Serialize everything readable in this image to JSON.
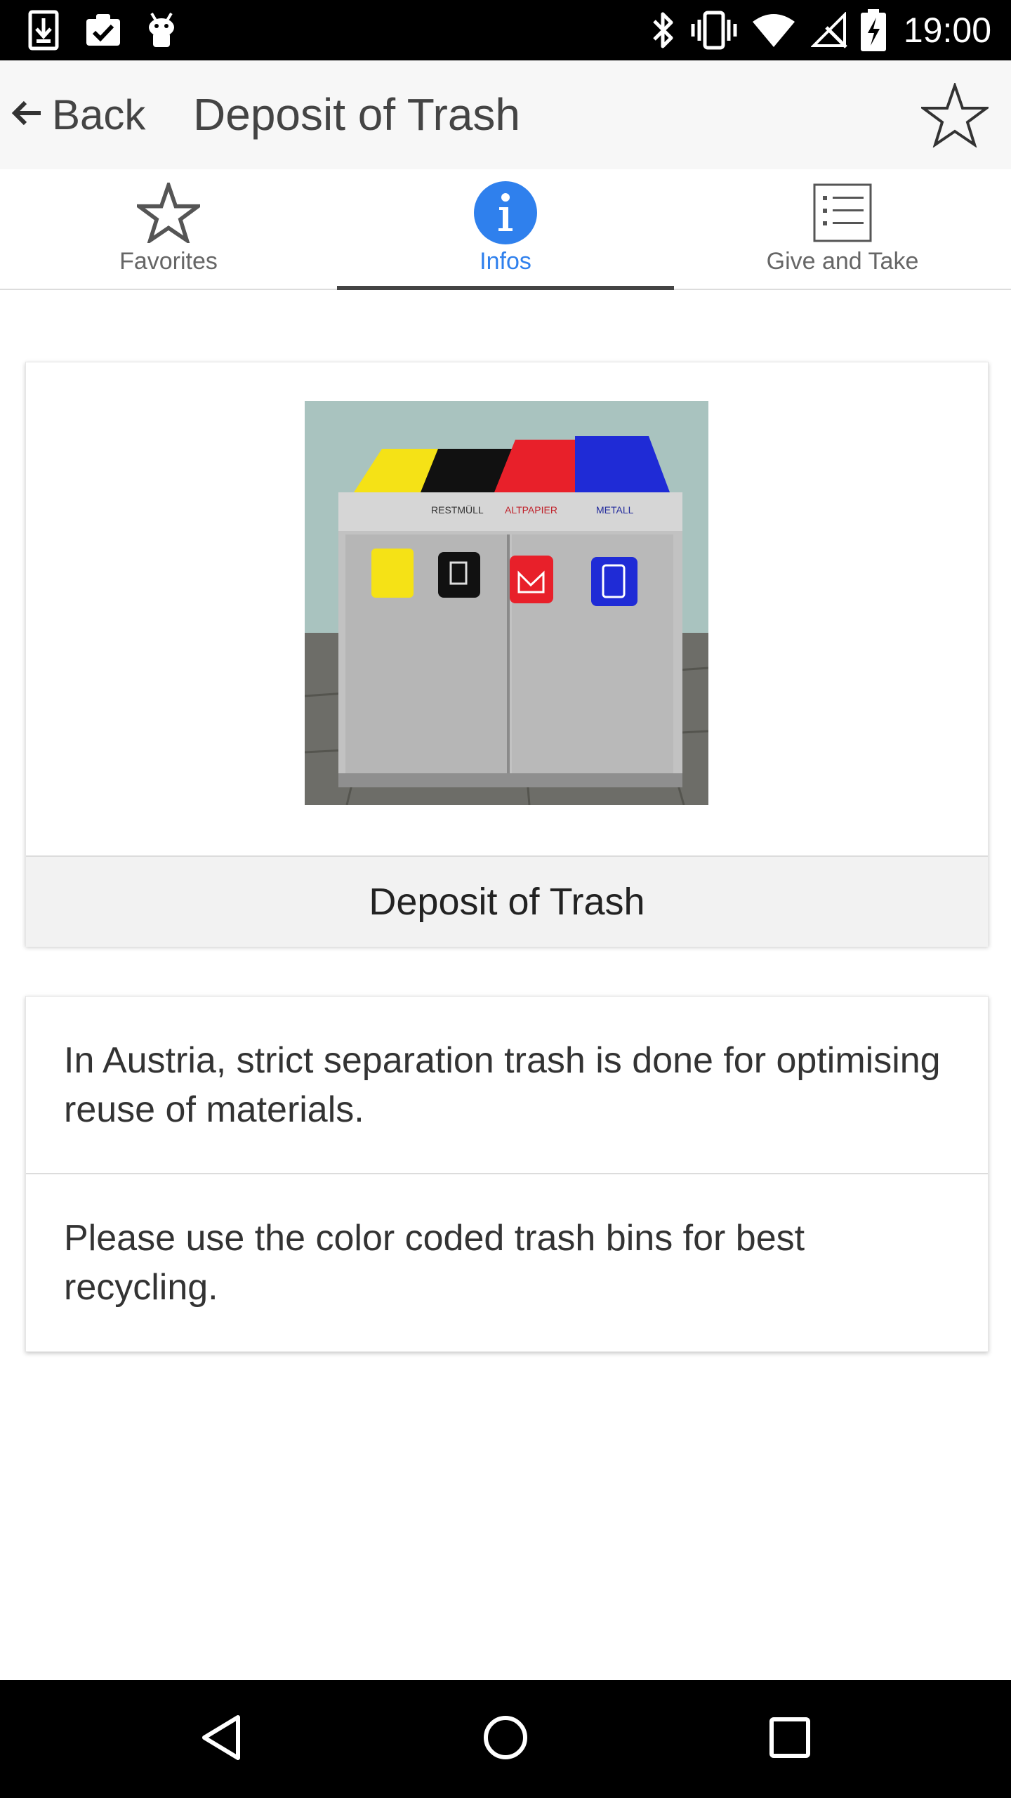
{
  "status_bar": {
    "time": "19:00",
    "left_icons": [
      "download-icon",
      "clipboard-check-icon",
      "android-icon"
    ],
    "right_icons": [
      "bluetooth-icon",
      "vibrate-icon",
      "wifi-icon",
      "no-signal-icon",
      "battery-charging-icon"
    ]
  },
  "toolbar": {
    "back_label": "Back",
    "title": "Deposit of Trash",
    "favorite_icon": "star-outline-icon"
  },
  "tabs": [
    {
      "label": "Favorites",
      "icon": "star-outline-icon",
      "active": false
    },
    {
      "label": "Infos",
      "icon": "info-circle-icon",
      "active": true
    },
    {
      "label": "Give and Take",
      "icon": "list-icon",
      "active": false
    }
  ],
  "image_card": {
    "caption": "Deposit of Trash",
    "bin_labels": [
      "RESTMÜLL",
      "ALTPAPIER",
      "METALL"
    ]
  },
  "info_items": [
    "In Austria, strict separation trash is done for optimising reuse of materials.",
    "Please use the color coded trash bins for best recycling."
  ],
  "nav_bar": {
    "buttons": [
      "back-triangle-icon",
      "home-circle-icon",
      "recents-square-icon"
    ]
  },
  "colors": {
    "accent": "#2f80ed",
    "tab_indicator": "#444444",
    "toolbar_bg": "#f7f7f7",
    "bin_yellow": "#f5e216",
    "bin_black": "#111111",
    "bin_red": "#e8202a",
    "bin_blue": "#1f2bd6"
  }
}
